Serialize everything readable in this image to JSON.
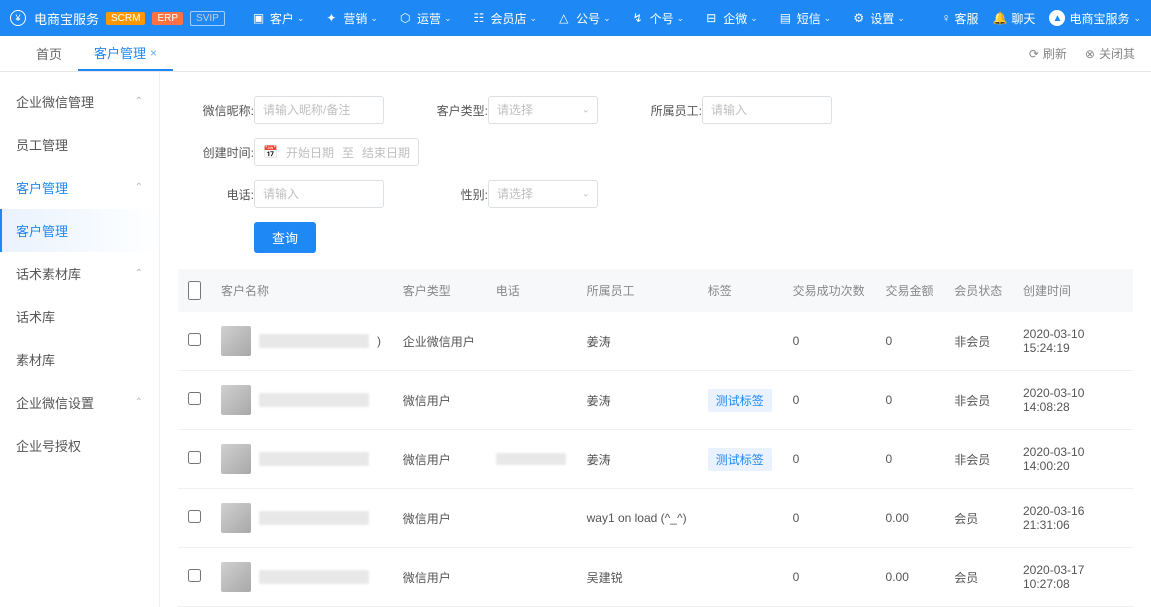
{
  "header": {
    "brand": "电商宝服务",
    "badges": {
      "scrm": "SCRM",
      "erp": "ERP",
      "svip": "SVIP"
    },
    "menu": [
      {
        "label": "客户"
      },
      {
        "label": "营销"
      },
      {
        "label": "运营"
      },
      {
        "label": "会员店"
      },
      {
        "label": "公号"
      },
      {
        "label": "个号"
      },
      {
        "label": "企微"
      },
      {
        "label": "短信"
      },
      {
        "label": "设置"
      }
    ],
    "right": {
      "service": "客服",
      "chat": "聊天",
      "account": "电商宝服务"
    }
  },
  "tabs": {
    "home": "首页",
    "active": "客户管理",
    "refresh": "刷新",
    "close_others": "关闭其"
  },
  "sidebar": {
    "items": [
      {
        "label": "企业微信管理",
        "chev": true
      },
      {
        "label": "员工管理"
      },
      {
        "label": "客户管理",
        "chev": true,
        "section": true
      },
      {
        "label": "客户管理",
        "active": true
      },
      {
        "label": "话术素材库",
        "chev": true
      },
      {
        "label": "话术库"
      },
      {
        "label": "素材库"
      },
      {
        "label": "企业微信设置",
        "chev": true
      },
      {
        "label": "企业号授权"
      }
    ]
  },
  "form": {
    "nickname_label": "微信昵称:",
    "nickname_ph": "请输入昵称/备注",
    "type_label": "客户类型:",
    "type_ph": "请选择",
    "staff_label": "所属员工:",
    "staff_ph": "请输入",
    "create_label": "创建时间:",
    "date_start_ph": "开始日期",
    "date_sep": "至",
    "date_end_ph": "结束日期",
    "phone_label": "电话:",
    "phone_ph": "请输入",
    "gender_label": "性别:",
    "gender_ph": "请选择",
    "submit": "查询"
  },
  "table": {
    "headers": {
      "name": "客户名称",
      "type": "客户类型",
      "phone": "电话",
      "staff": "所属员工",
      "tag": "标签",
      "deals": "交易成功次数",
      "amount": "交易金额",
      "member": "会员状态",
      "created": "创建时间"
    },
    "rows": [
      {
        "name": ")",
        "type": "企业微信用户",
        "phone": "",
        "staff": "姜涛",
        "tag": "",
        "deals": "0",
        "amount": "0",
        "member": "非会员",
        "created": "2020-03-10 15:24:19"
      },
      {
        "name": "",
        "type": "微信用户",
        "phone": "",
        "staff": "姜涛",
        "tag": "测试标签",
        "deals": "0",
        "amount": "0",
        "member": "非会员",
        "created": "2020-03-10 14:08:28"
      },
      {
        "name": "",
        "type": "微信用户",
        "phone": "·",
        "staff": "姜涛",
        "tag": "测试标签",
        "deals": "0",
        "amount": "0",
        "member": "非会员",
        "created": "2020-03-10 14:00:20"
      },
      {
        "name": "",
        "type": "微信用户",
        "phone": "",
        "staff": "way1 on load (^_^)",
        "tag": "",
        "deals": "0",
        "amount": "0.00",
        "member": "会员",
        "created": "2020-03-16 21:31:06"
      },
      {
        "name": "",
        "type": "微信用户",
        "phone": "",
        "staff": "吴建锐",
        "tag": "",
        "deals": "0",
        "amount": "0.00",
        "member": "会员",
        "created": "2020-03-17 10:27:08"
      }
    ]
  }
}
